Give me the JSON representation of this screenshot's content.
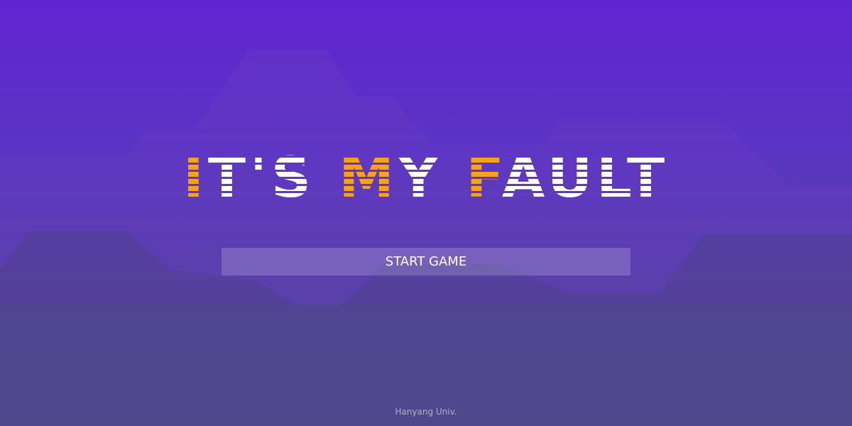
{
  "title": {
    "part1": "IT'S",
    "part2_orange": "M",
    "part2_white": "Y",
    "part3_orange": "F",
    "part3_white": "AULT"
  },
  "start_button_label": "START GAME",
  "footer_text": "Hanyang Univ.",
  "colors": {
    "title_white": "#ffffff",
    "title_accent": "#f7a21c",
    "background_top": "#6224d0",
    "background_bottom": "#4e5082"
  }
}
